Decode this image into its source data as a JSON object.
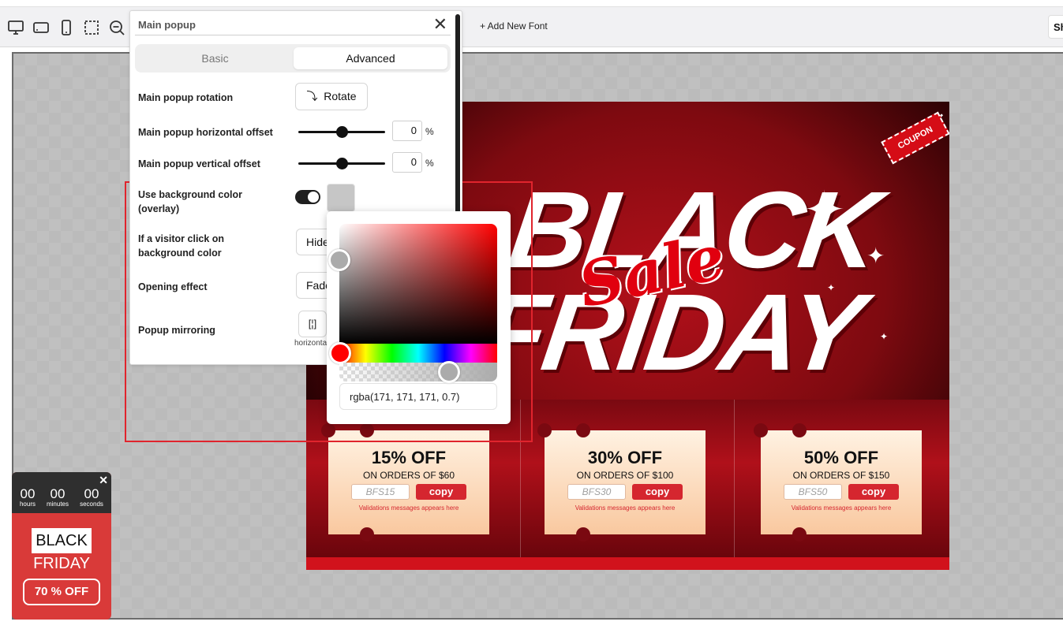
{
  "toolbar": {
    "icons": [
      "desktop-icon",
      "tablet-landscape-icon",
      "mobile-icon",
      "selection-icon",
      "zoom-out-icon"
    ],
    "add_font_label": "+ Add New Font",
    "show_label": "Sh"
  },
  "panel": {
    "title": "Main popup",
    "tabs": {
      "basic": "Basic",
      "advanced": "Advanced"
    },
    "rotation_label": "Main popup rotation",
    "rotate_button": "Rotate",
    "h_offset_label": "Main popup horizontal offset",
    "h_offset_value": "0",
    "v_offset_label": "Main popup vertical offset",
    "v_offset_value": "0",
    "percent": "%",
    "bg_color_label_1": "Use background color",
    "bg_color_label_2": "(overlay)",
    "click_label_1": "If a visitor click on",
    "click_label_2": "background color",
    "click_value": "Hide",
    "opening_label": "Opening effect",
    "opening_value": "Fade",
    "mirror_label": "Popup mirroring",
    "mirror_caption": "horizonta",
    "overlay_enabled": true,
    "h_offset_slider_level": 0.5,
    "v_offset_slider_level": 0.5
  },
  "picker": {
    "value": "rgba(171, 171, 171, 0.7)",
    "hue": 0,
    "alpha": 0.7
  },
  "popup": {
    "coupon_tag": "COUPON",
    "headline_1": "BLACK",
    "headline_2": "FRIDAY",
    "sale_script": "Sale",
    "coupons": [
      {
        "off": "15% OFF",
        "on": "ON ORDERS OF $60",
        "code": "BFS15",
        "copy": "copy",
        "msg": "Validations messages appears here"
      },
      {
        "off": "30% OFF",
        "on": "ON ORDERS OF $100",
        "code": "BFS30",
        "copy": "copy",
        "msg": "Validations messages appears here"
      },
      {
        "off": "50% OFF",
        "on": "ON ORDERS OF $150",
        "code": "BFS50",
        "copy": "copy",
        "msg": "Validations messages appears here"
      }
    ]
  },
  "sticky": {
    "hours": "00",
    "hours_label": "hours",
    "minutes": "00",
    "minutes_label": "minutes",
    "seconds": "00",
    "seconds_label": "seconds",
    "black": "BLACK",
    "friday": "FRIDAY",
    "off": "70 % OFF"
  },
  "colors": {
    "accent_red": "#d5262f",
    "selection_border": "#e0242d",
    "overlay": "rgba(171, 171, 171, 0.7)"
  }
}
